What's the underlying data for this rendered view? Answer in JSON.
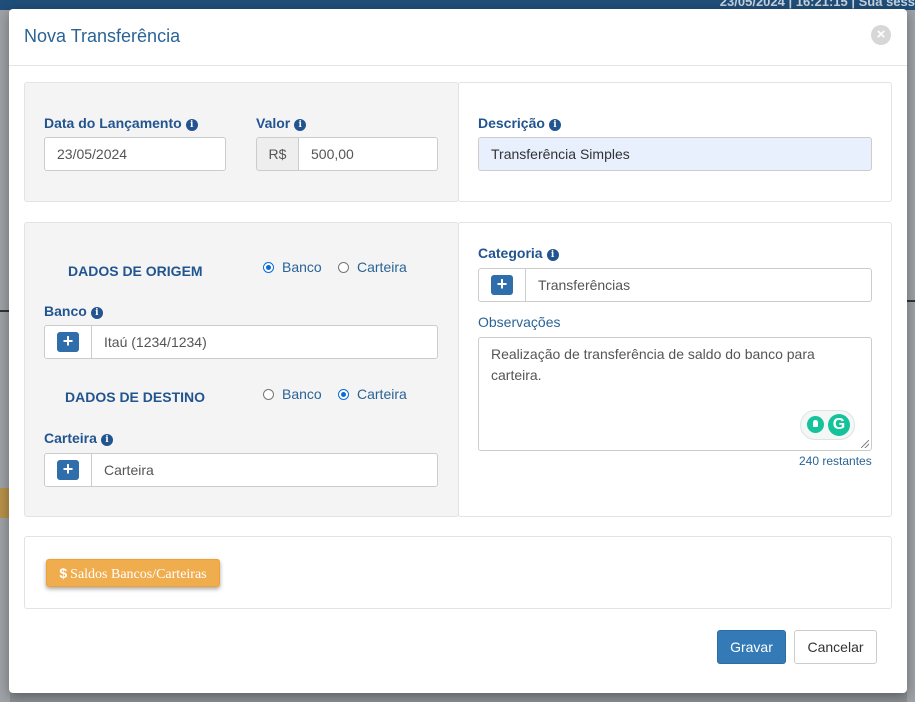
{
  "background": {
    "topbar_text": "23/05/2024  |  16:21:15  |  Sua sess"
  },
  "modal": {
    "title": "Nova Transferência",
    "close_icon": "times-circle-icon"
  },
  "lancamento": {
    "data_label": "Data do Lançamento",
    "data_value": "23/05/2024",
    "valor_label": "Valor",
    "valor_prefix": "R$",
    "valor_value": "500,00"
  },
  "descricao": {
    "label": "Descrição",
    "value": "Transferência Simples"
  },
  "origem": {
    "section_title": "DADOS DE ORIGEM",
    "options": [
      {
        "label": "Banco",
        "checked": true
      },
      {
        "label": "Carteira",
        "checked": false
      }
    ],
    "field_label": "Banco",
    "field_value": "Itaú (1234/1234)"
  },
  "destino": {
    "section_title": "DADOS DE DESTINO",
    "options": [
      {
        "label": "Banco",
        "checked": false
      },
      {
        "label": "Carteira",
        "checked": true
      }
    ],
    "field_label": "Carteira",
    "field_value": "Carteira"
  },
  "categoria": {
    "label": "Categoria",
    "value": "Transferências"
  },
  "observacoes": {
    "label": "Observações",
    "value": "Realização de transferência de saldo do banco para carteira.",
    "counter": "240 restantes"
  },
  "footer_panel": {
    "saldos_button": "Saldos Bancos/Carteiras",
    "saldos_icon_glyph": "$"
  },
  "actions": {
    "save": "Gravar",
    "cancel": "Cancelar"
  },
  "colors": {
    "primary": "#337ab7",
    "warning": "#f0ad4e",
    "label_blue": "#22558f"
  }
}
